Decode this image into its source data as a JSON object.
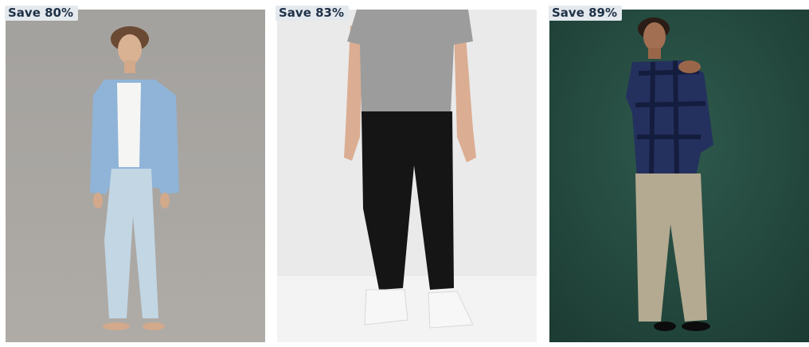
{
  "products": [
    {
      "badge": "Save 80%",
      "image": "man-light-denim-shirt-light-jeans-photo"
    },
    {
      "badge": "Save 83%",
      "image": "man-grey-tee-black-jeans-white-sneakers-photo"
    },
    {
      "badge": "Save 89%",
      "image": "man-navy-flannel-khaki-pants-photo"
    }
  ],
  "colors": {
    "badge_bg": "#e4e9ee",
    "badge_text": "#1f3147",
    "card1_bg": "#a9a7a4",
    "card2_bg": "#eaeaea",
    "card3_bg": "#22463c"
  }
}
